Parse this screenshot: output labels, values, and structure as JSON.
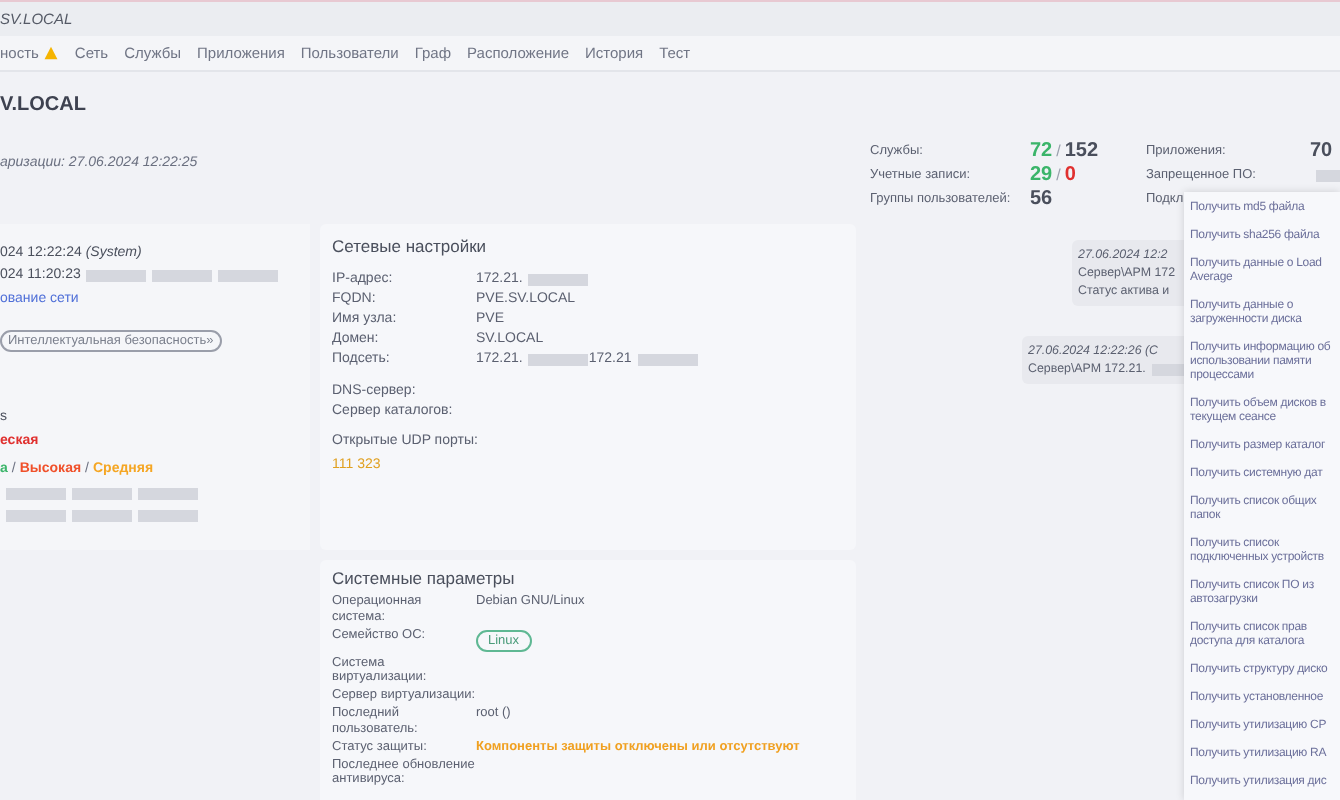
{
  "header": {
    "title": "SV.LOCAL"
  },
  "nav": [
    {
      "label": "ность",
      "warning": true
    },
    {
      "label": "Сеть",
      "warning": false
    },
    {
      "label": "Службы",
      "warning": false
    },
    {
      "label": "Приложения",
      "warning": false
    },
    {
      "label": "Пользователи",
      "warning": false
    },
    {
      "label": "Граф",
      "warning": false
    },
    {
      "label": "Расположение",
      "warning": false
    },
    {
      "label": "История",
      "warning": false
    },
    {
      "label": "Тест",
      "warning": false
    }
  ],
  "host": {
    "title": "V.LOCAL",
    "date": "аризации: 27.06.2024 12:22:25"
  },
  "stats": [
    {
      "label": "Службы:",
      "parts": [
        {
          "text": "72",
          "kind": "ok"
        },
        {
          "text": "/",
          "kind": "sep"
        },
        {
          "text": "152",
          "kind": "total"
        }
      ]
    },
    {
      "label": "Учетные записи:",
      "parts": [
        {
          "text": "29",
          "kind": "ok"
        },
        {
          "text": "/",
          "kind": "sep"
        },
        {
          "text": "0",
          "kind": "bad"
        }
      ]
    },
    {
      "label": "Группы пользователей:",
      "parts": [
        {
          "text": "56",
          "kind": "total"
        }
      ]
    },
    {
      "label": "Приложения:",
      "parts": [
        {
          "text": "70",
          "kind": "total"
        }
      ]
    },
    {
      "label": "Запрещенное ПО:",
      "parts": [
        {
          "kind": "redacted"
        }
      ]
    },
    {
      "label": "Подкл"
    }
  ],
  "summary": [
    {
      "kind": "text",
      "text": "024 12:22:24 *(System)*"
    },
    {
      "kind": "text",
      "text": "024 11:20:23",
      "redacted": true
    },
    {
      "kind": "link",
      "text": "ование сети"
    },
    {
      "kind": "badge",
      "text": "Интеллектуальная безопасность»"
    },
    {
      "kind": "text",
      "text": "s"
    },
    {
      "kind": "severity",
      "parts": [
        {
          "text": "еская",
          "kind": "critical"
        }
      ]
    },
    {
      "kind": "severity",
      "parts": [
        {
          "text": "а",
          "kind": "low"
        },
        {
          "text": "/",
          "kind": "sep"
        },
        {
          "text": "Высокая",
          "kind": "high"
        },
        {
          "text": "/",
          "kind": "sep"
        },
        {
          "text": "Средняя",
          "kind": "medium"
        }
      ]
    },
    {
      "kind": "text",
      "redacted": true
    },
    {
      "kind": "text",
      "redacted": true
    }
  ],
  "network": {
    "title": "Сетевые настройки",
    "rows": [
      {
        "label": "IP-адрес:",
        "value": [
          {
            "text": "172.21."
          },
          {
            "kind": "redacted"
          }
        ]
      },
      {
        "label": "FQDN:",
        "value": [
          {
            "text": "PVE.SV.LOCAL"
          }
        ]
      },
      {
        "label": "Имя узла:",
        "value": [
          {
            "text": "PVE"
          }
        ]
      },
      {
        "label": "Домен:",
        "value": [
          {
            "text": "SV.LOCAL"
          }
        ]
      },
      {
        "label": "Подсеть:",
        "value": [
          {
            "text": "172.21."
          },
          {
            "kind": "redacted"
          },
          {
            "text": "172.21"
          },
          {
            "kind": "redacted"
          }
        ]
      }
    ],
    "servers": [
      "DNS-сервер:",
      "Сервер каталогов:"
    ],
    "udp_label": "Открытые UDP порты:",
    "udp_value": "111 323"
  },
  "system": {
    "title": "Системные параметры",
    "rows": [
      {
        "label": "Операционная система:",
        "kind": "text",
        "value": "Debian GNU/Linux"
      },
      {
        "label": "Семейство ОС:",
        "kind": "badge",
        "value": "Linux"
      },
      {
        "label": "Система виртуализации:"
      },
      {
        "label": "Сервер виртуализации:"
      },
      {
        "label": "Последний пользователь:",
        "kind": "text",
        "value": "root ()"
      },
      {
        "label": "Статус защиты:",
        "kind": "warning",
        "value": "Компоненты защиты отключены или отсутствуют"
      },
      {
        "label": "Последнее обновление антивируса:"
      }
    ]
  },
  "events": [
    {
      "lines": [
        "27.06.2024 12:2",
        "Сервер\\АРМ 172",
        "Статус актива и"
      ]
    },
    {
      "lines": [
        "27.06.2024 12:22:26 (С",
        "Сервер\\АРМ 172.21."
      ],
      "redacted": true
    }
  ],
  "menu": [
    "Получить md5 файла",
    "Получить sha256 файла",
    "Получить данные о Load Average",
    "Получить данные о загруженности диска",
    "Получить информацию об использовании памяти процессами",
    "Получить объем дисков в текущем сеансе",
    "Получить размер каталог",
    "Получить системную дат",
    "Получить список общих папок",
    "Получить список подключенных устройств",
    "Получить список ПО из автозагрузки",
    "Получить список прав доступа для каталога",
    "Получить структуру диско",
    "Получить установленное",
    "Получить утилизацию CP",
    "Получить утилизацию RA",
    "Получить утилизация дис"
  ]
}
